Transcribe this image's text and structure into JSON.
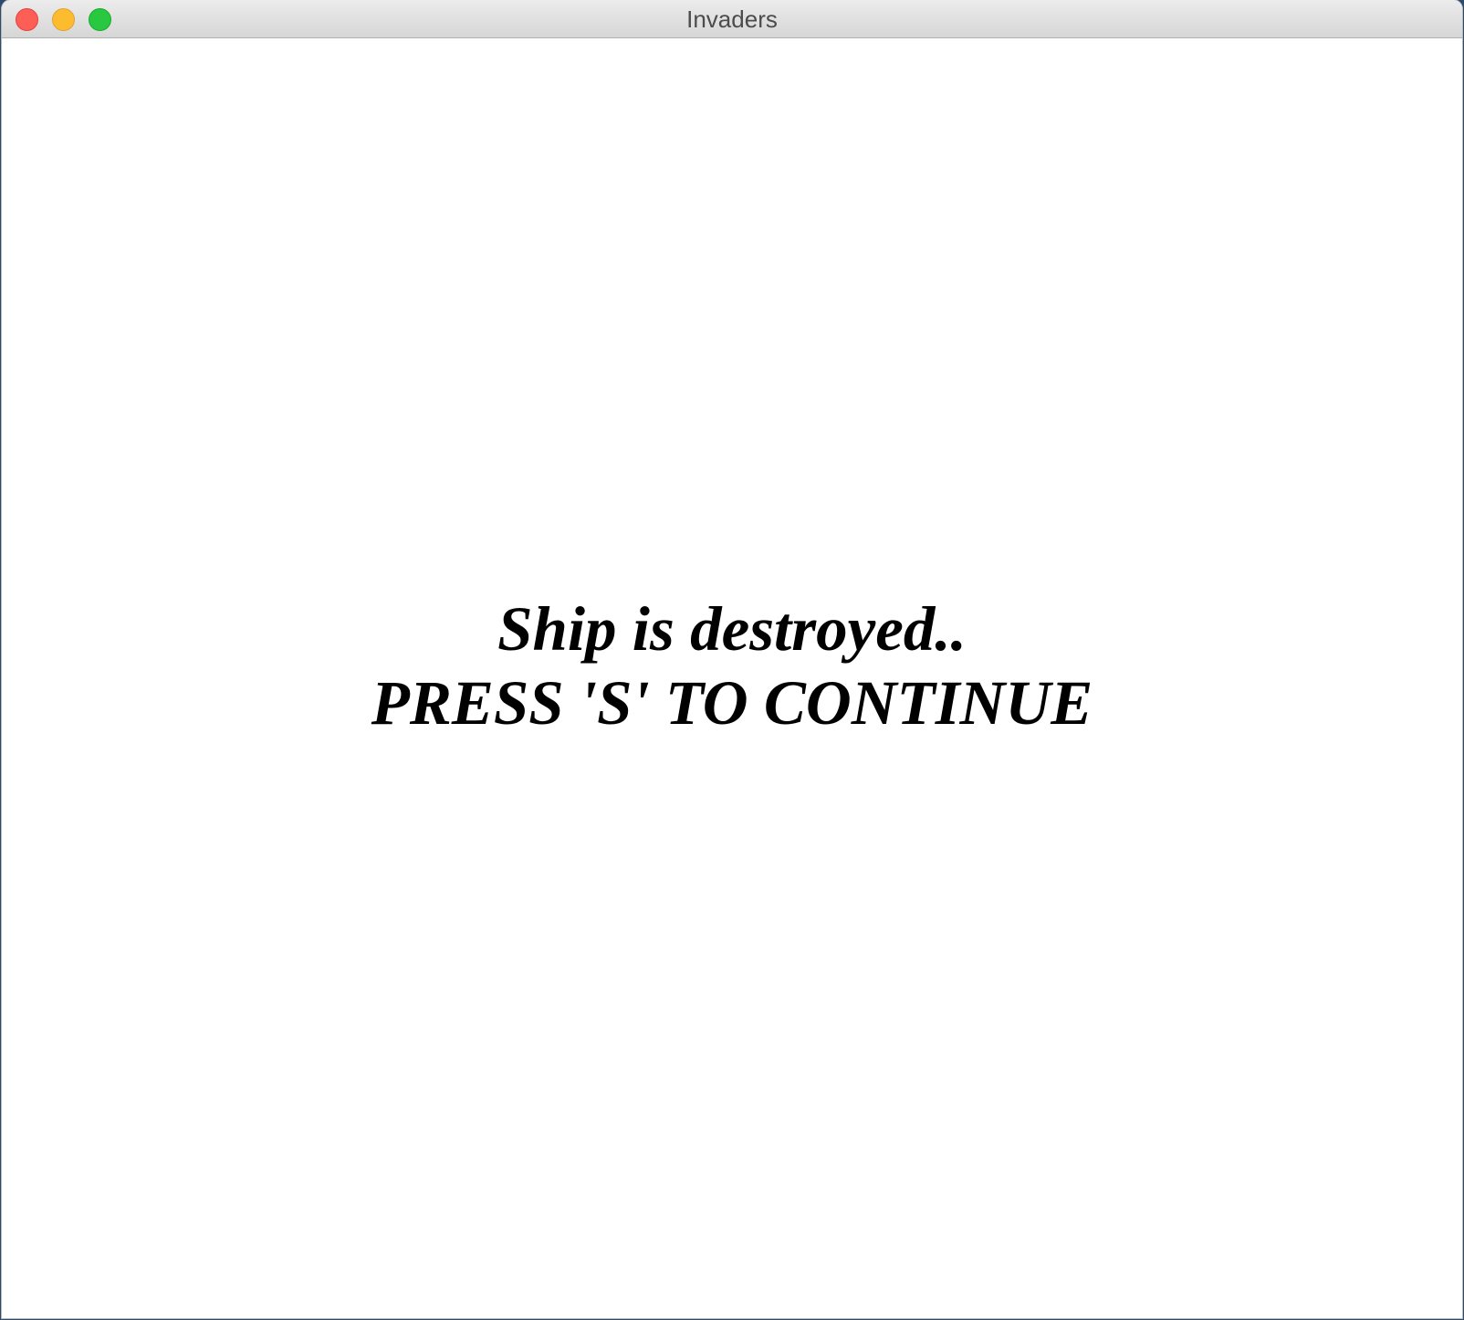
{
  "window": {
    "title": "Invaders",
    "controls": {
      "close": "close",
      "minimize": "minimize",
      "zoom": "zoom"
    }
  },
  "game": {
    "message_line1": "Ship is destroyed..",
    "message_line2": "PRESS 'S' TO CONTINUE"
  },
  "colors": {
    "background": "#ffffff",
    "text": "#000000",
    "close": "#fd5f57",
    "minimize": "#fdbc2e",
    "zoom": "#28c840"
  }
}
